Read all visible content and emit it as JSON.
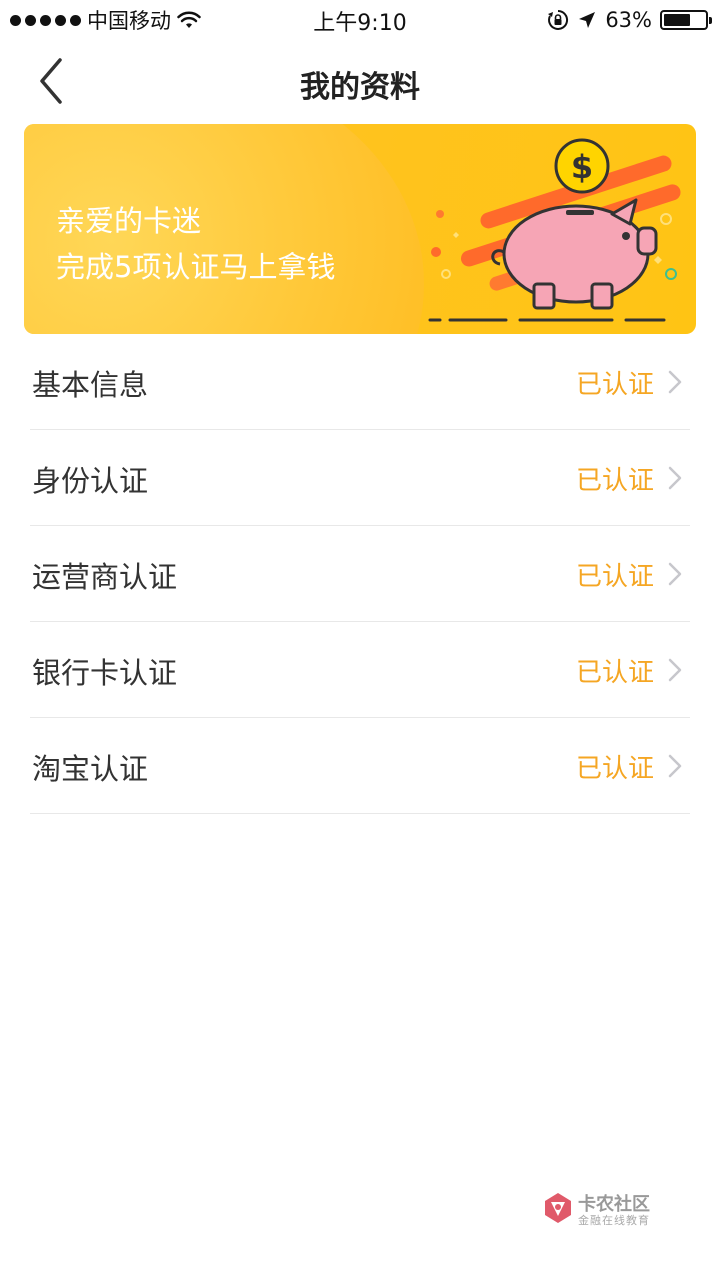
{
  "status_bar": {
    "carrier": "中国移动",
    "time": "上午9:10",
    "battery": "63%"
  },
  "nav": {
    "title": "我的资料"
  },
  "banner": {
    "line1": "亲爱的卡迷",
    "line2": "完成5项认证马上拿钱"
  },
  "items": [
    {
      "label": "基本信息",
      "status": "已认证"
    },
    {
      "label": "身份认证",
      "status": "已认证"
    },
    {
      "label": "运营商认证",
      "status": "已认证"
    },
    {
      "label": "银行卡认证",
      "status": "已认证"
    },
    {
      "label": "淘宝认证",
      "status": "已认证"
    }
  ],
  "watermark": {
    "title": "卡农社区",
    "subtitle": "金融在线教育"
  },
  "colors": {
    "accent": "#f5a623",
    "banner": "#ffc31e",
    "pig": "#f6a5b5"
  }
}
